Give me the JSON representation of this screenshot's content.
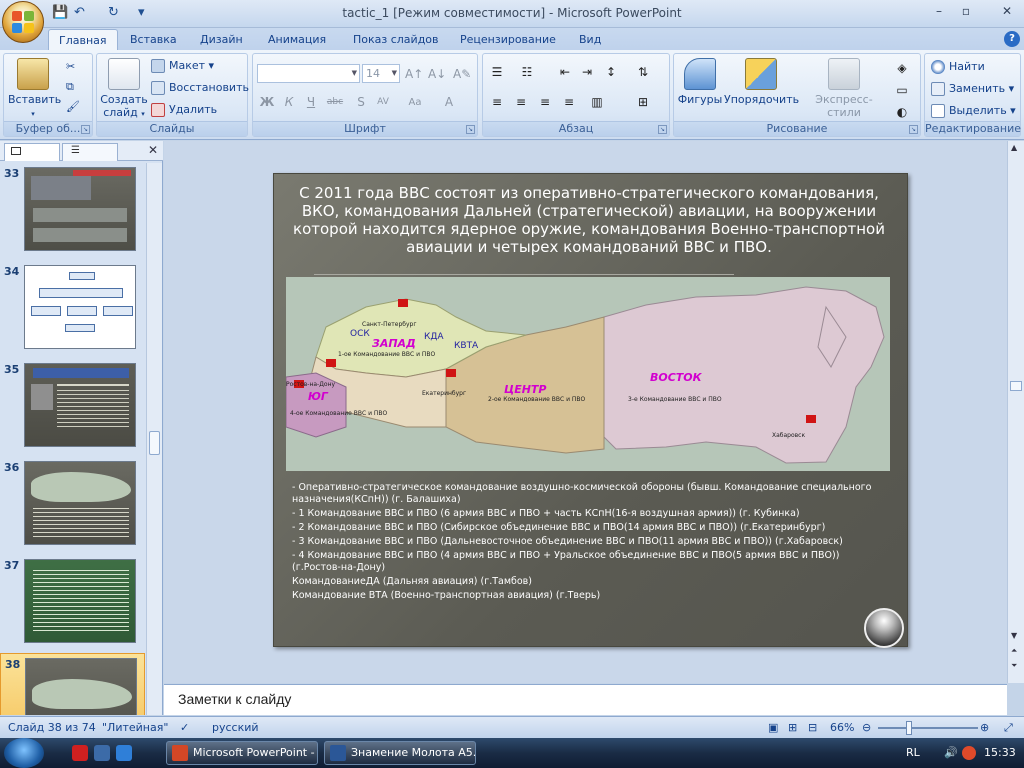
{
  "window": {
    "title": "tactic_1 [Режим совместимости] - Microsoft PowerPoint",
    "buttons": {
      "minimize": "–",
      "restore": "▫",
      "close": "✕"
    }
  },
  "quick_access": {
    "save": "💾",
    "undo": "↶",
    "redo": "↻",
    "more": "▾"
  },
  "ribbon_tabs": [
    "Главная",
    "Вставка",
    "Дизайн",
    "Анимация",
    "Показ слайдов",
    "Рецензирование",
    "Вид"
  ],
  "ribbon": {
    "clipboard": {
      "paste": "Вставить",
      "label": "Буфер об..."
    },
    "slides": {
      "create": "Создать слайд",
      "layout": "Макет",
      "reset": "Восстановить",
      "delete": "Удалить",
      "label": "Слайды"
    },
    "font": {
      "size_value": "14",
      "label": "Шрифт"
    },
    "paragraph": {
      "label": "Абзац"
    },
    "drawing": {
      "shapes": "Фигуры",
      "arrange": "Упорядочить",
      "express_styles": "Экспресс-стили",
      "label": "Рисование"
    },
    "editing": {
      "find": "Найти",
      "replace": "Заменить",
      "select": "Выделить",
      "label": "Редактирование"
    }
  },
  "thumbnails": [
    {
      "num": "33"
    },
    {
      "num": "34"
    },
    {
      "num": "35"
    },
    {
      "num": "36"
    },
    {
      "num": "37"
    },
    {
      "num": "38"
    }
  ],
  "slide": {
    "title_lines": [
      "С 2011 года ВВС  состоят из оперативно-стратегического командования,",
      "ВКО, командования Дальней (стратегической) авиации, на вооружении",
      "которой находится ядерное оружие, командования Военно-транспортной",
      "авиации и четырех командований ВВС и ПВО."
    ],
    "map": {
      "regions": {
        "west": "ЗАПАД",
        "south": "ЮГ",
        "center": "ЦЕНТР",
        "east": "ВОСТОК"
      },
      "abbr": {
        "osk": "ОСК",
        "kda": "КДА",
        "kvta": "КВТА"
      },
      "cities": {
        "spb": "Санкт-Петербург",
        "rostov": "Ростов-на-Дону",
        "ekb": "Екатеринбург",
        "khab": "Хабаровск"
      },
      "commands": {
        "c1": "1-ое Командование ВВС и ПВО",
        "c2": "2-ое Командование ВВС и ПВО",
        "c3": "3-е Командование ВВС и ПВО",
        "c4": "4-ое Командование ВВС и ПВО"
      }
    },
    "body": [
      "- Оперативно-стратегическое командование воздушно-космической обороны (бывш. Командование специального назначения(КСпН)) (г. Балашиха)",
      "- 1  Командование ВВС и ПВО (6 армия ВВС и ПВО + часть КСпН(16-я воздушная армия)) (г. Кубинка)",
      "- 2 Командование ВВС и ПВО (Сибирское объединение ВВС и ПВО(14 армия ВВС и ПВО)) (г.Екатеринбург)",
      "- 3 Командование ВВС и ПВО (Дальневосточное объединение ВВС и ПВО(11 армия ВВС и ПВО)) (г.Хабаровск)",
      "- 4 Командование ВВС и ПВО (4 армия ВВС и ПВО + Уральское объединение ВВС и ПВО(5 армия ВВС и ПВО)) (г.Ростов-на-Дону)",
      "КомандованиеДА (Дальняя авиация) (г.Тамбов)",
      "Командование ВТА (Военно-транспортная авиация) (г.Тверь)"
    ]
  },
  "notes_placeholder": "Заметки к слайду",
  "status": {
    "slide": "Слайд 38 из 74",
    "theme": "\"Литейная\"",
    "language": "русский",
    "zoom": "66%"
  },
  "taskbar": {
    "tasks": [
      "Microsoft PowerPoint - ...",
      "Знамение Молота A5..."
    ],
    "lang": "RL",
    "time": "15:33"
  }
}
